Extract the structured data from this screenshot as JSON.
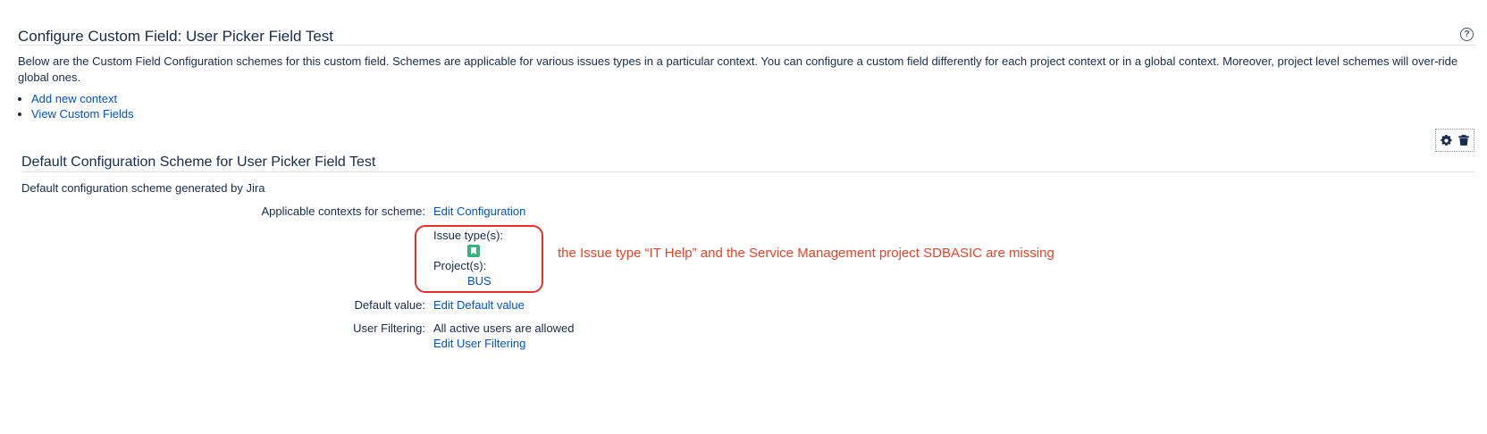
{
  "page": {
    "title": "Configure Custom Field: User Picker Field Test",
    "help_icon": "question-circle-icon",
    "description": "Below are the Custom Field Configuration schemes for this custom field. Schemes are applicable for various issues types in a particular context. You can configure a custom field differently for each project context or in a global context. Moreover, project level schemes will over-ride global ones.",
    "links": [
      {
        "label": "Add new context"
      },
      {
        "label": "View Custom Fields"
      }
    ]
  },
  "operations": {
    "configure_icon": "gear-icon",
    "delete_icon": "trash-icon"
  },
  "scheme": {
    "title": "Default Configuration Scheme for User Picker Field Test",
    "description": "Default configuration scheme generated by Jira",
    "contexts_label": "Applicable contexts for scheme:",
    "edit_configuration": "Edit Configuration",
    "issue_types_label": "Issue type(s):",
    "issue_type_icon": "issue-type-icon",
    "projects_label": "Project(s):",
    "project": "BUS",
    "default_value_label": "Default value:",
    "edit_default_value": "Edit Default value",
    "user_filtering_label": "User Filtering:",
    "user_filtering_value": "All active users are allowed",
    "edit_user_filtering": "Edit User Filtering"
  },
  "annotation": {
    "text": "the Issue type “IT Help” and the Service Management project SDBASIC are missing",
    "color": "#e8432a"
  },
  "colors": {
    "link": "#0052cc",
    "text": "#172b4d",
    "issue_type": "#36b37e",
    "highlight": "#e8302a"
  }
}
